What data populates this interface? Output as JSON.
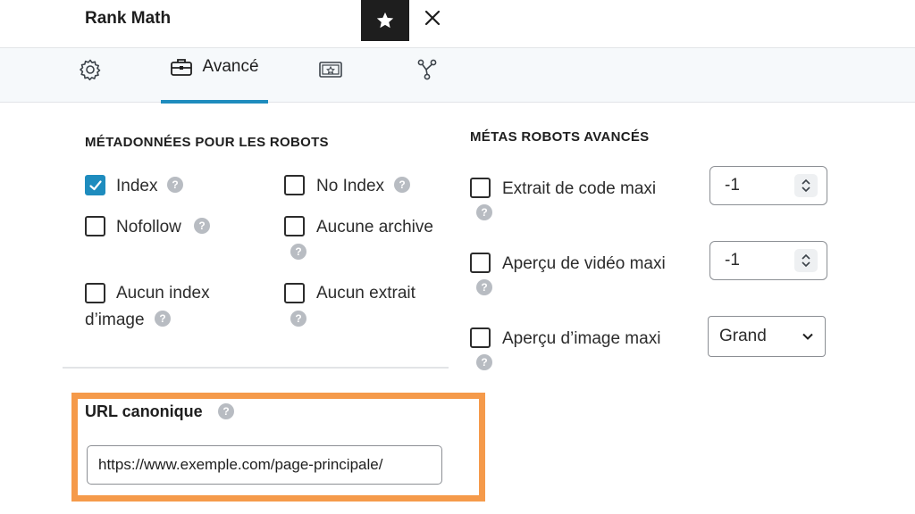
{
  "header": {
    "title": "Rank Math"
  },
  "tabs": {
    "advanced_label": "Avancé"
  },
  "robots_meta": {
    "title": "MÉTADONNÉES POUR LES ROBOTS",
    "items": [
      {
        "label": "Index",
        "checked": true
      },
      {
        "label": "No Index",
        "checked": false
      },
      {
        "label": "Nofollow",
        "checked": false
      },
      {
        "label": "Aucune archive",
        "checked": false
      },
      {
        "label": "Aucun index",
        "label2": "d’image",
        "checked": false
      },
      {
        "label": "Aucun extrait",
        "checked": false
      }
    ]
  },
  "advanced_robots": {
    "title": "MÉTAS ROBOTS AVANCÉS",
    "snippet": {
      "label": "Extrait de code maxi",
      "value": "-1"
    },
    "video": {
      "label": "Aperçu de vidéo maxi",
      "value": "-1"
    },
    "image": {
      "label": "Aperçu d’image maxi",
      "value": "Grand"
    }
  },
  "canonical": {
    "label": "URL canonique",
    "value": "https://www.exemple.com/page-principale/"
  },
  "help_glyph": "?",
  "colors": {
    "accent": "#1e8cbe",
    "highlight": "#f59a4a",
    "dark": "#1e1e1e"
  }
}
